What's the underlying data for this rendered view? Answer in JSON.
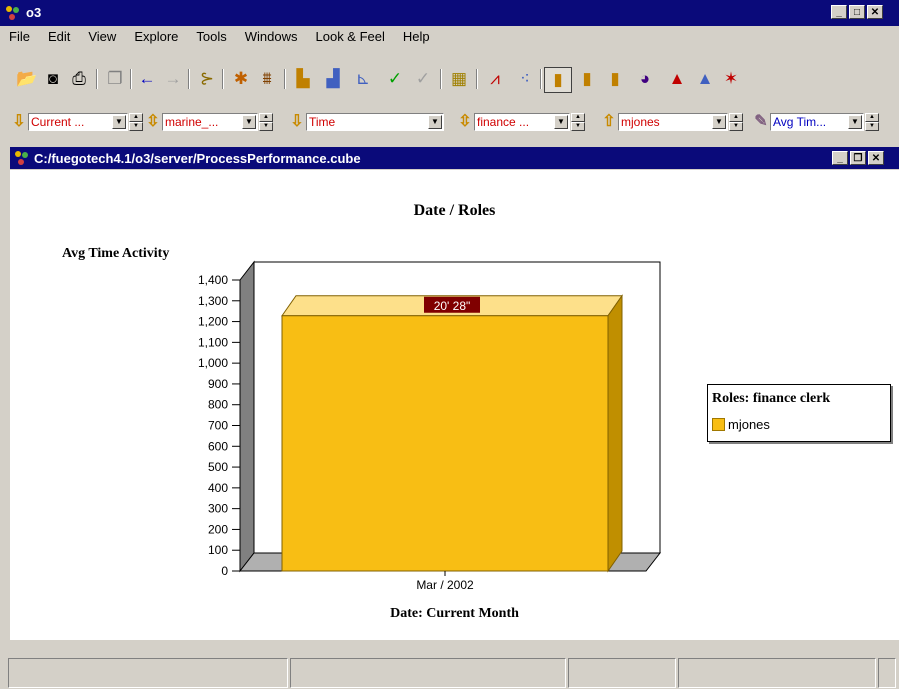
{
  "window": {
    "title": "o3"
  },
  "menu": [
    "File",
    "Edit",
    "View",
    "Explore",
    "Tools",
    "Windows",
    "Look & Feel",
    "Help"
  ],
  "toolbar_icons": [
    "open-icon",
    "camera-icon",
    "print-icon",
    "copy-icon",
    "back-icon",
    "forward-icon",
    "tree-icon",
    "paint-icon",
    "grid-icon",
    "bar-chart-icon",
    "stacked-bar-icon",
    "area-chart-icon",
    "check-icon",
    "uncheck-icon",
    "table-icon",
    "line-chart-icon",
    "scatter-chart-icon",
    "column-chart-icon",
    "column-chart-2-icon",
    "column-chart-3-icon",
    "pie-chart-icon",
    "mountain-chart-icon",
    "mountain-chart-2-icon",
    "radar-chart-icon"
  ],
  "dimensions": [
    {
      "icon": "arrow-down-icon",
      "glyph": "⇩",
      "value": "Current ..."
    },
    {
      "icon": "arrow-updown-icon",
      "glyph": "⇳",
      "value": "marine_..."
    },
    {
      "icon": "arrow-down-icon",
      "glyph": "⇩",
      "value": "Time"
    },
    {
      "icon": "arrow-updown-icon",
      "glyph": "⇳",
      "value": "finance ..."
    },
    {
      "icon": "arrow-up-icon",
      "glyph": "⇧",
      "value": "mjones"
    },
    {
      "icon": "ruler-icon",
      "glyph": "✎",
      "value": "Avg Tim..."
    }
  ],
  "inner_window": {
    "title": "C:/fuegotech4.1/o3/server/ProcessPerformance.cube"
  },
  "chart_data": {
    "type": "bar",
    "title": "Date / Roles",
    "ylabel": "Avg Time Activity",
    "xlabel": "Date: Current Month",
    "categories": [
      "Mar / 2002"
    ],
    "series": [
      {
        "name": "mjones",
        "values": [
          1228
        ]
      }
    ],
    "data_labels": [
      "20' 28\""
    ],
    "ylim": [
      0,
      1400
    ],
    "yticks": [
      "0",
      "100",
      "200",
      "300",
      "400",
      "500",
      "600",
      "700",
      "800",
      "900",
      "1,000",
      "1,100",
      "1,200",
      "1,300",
      "1,400"
    ],
    "legend": {
      "title": "Roles: finance clerk",
      "placement": "right"
    },
    "bar_color": "#f8be14"
  },
  "colors": {
    "titlebar": "#0a0a7a",
    "dim_text": "#d00000",
    "bar": "#f8be14",
    "label_bg": "#800000"
  }
}
